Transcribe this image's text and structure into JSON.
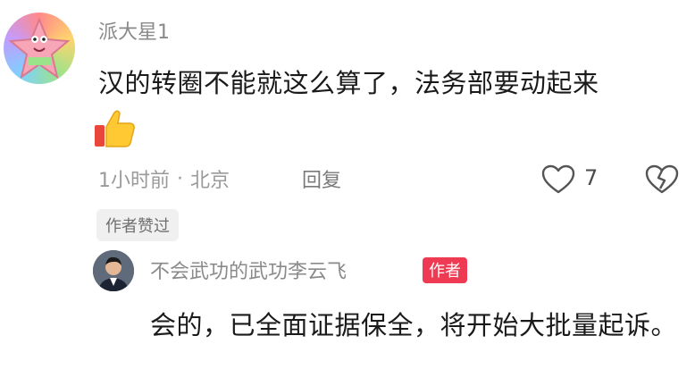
{
  "comment": {
    "username": "派大星1",
    "text": "汉的转圈不能就这么算了，法务部要动起来",
    "emoji": "thumbs-up-icon",
    "time": "1小时前",
    "separator": "·",
    "location": "北京",
    "reply_label": "回复",
    "like_count": "7",
    "author_liked_badge": "作者赞过"
  },
  "reply": {
    "username": "不会武功的武功李云飞",
    "author_tag": "作者",
    "text": "会的，已全面证据保全，将开始大批量起诉。"
  }
}
